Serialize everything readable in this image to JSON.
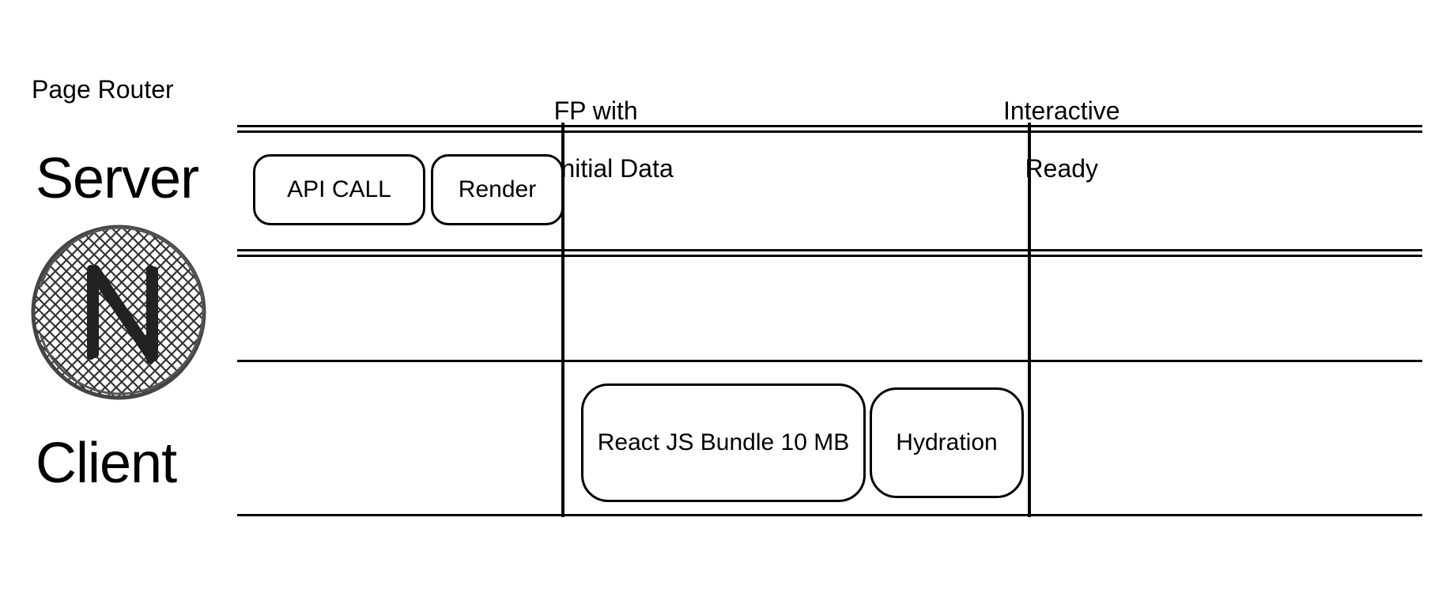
{
  "title": "Page Router",
  "lanes": {
    "server": "Server",
    "client": "Client"
  },
  "markers": {
    "fp": {
      "line1": "FP with",
      "line2": "Initial Data"
    },
    "ready": {
      "line1": "Interactive",
      "line2": "Ready"
    }
  },
  "tasks": {
    "api": "API CALL",
    "render": "Render",
    "bundle": "React JS Bundle 10 MB",
    "hydration": "Hydration"
  },
  "logo_semantic": "nextjs-sketch-logo"
}
